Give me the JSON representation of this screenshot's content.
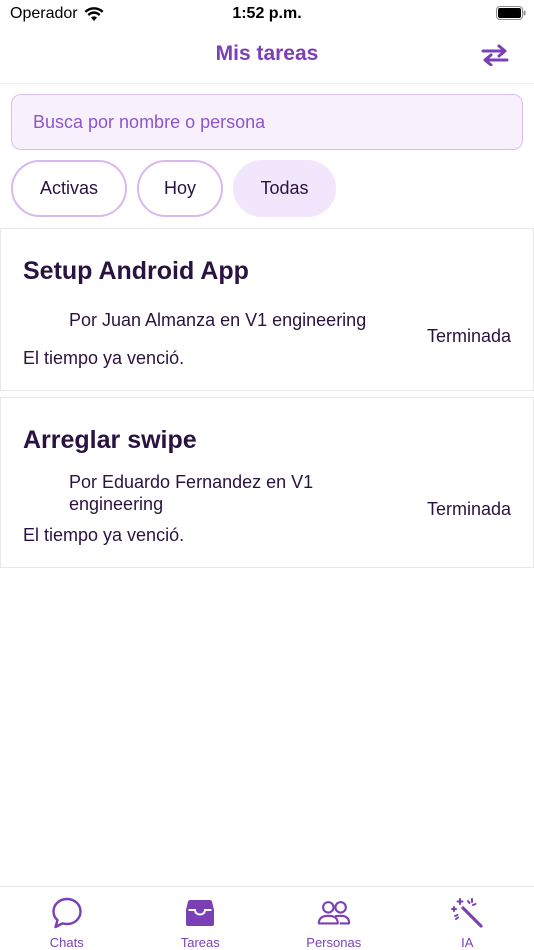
{
  "status_bar": {
    "carrier": "Operador",
    "time": "1:52 p.m."
  },
  "header": {
    "title": "Mis tareas",
    "swap_icon": "swap-arrows-icon"
  },
  "search": {
    "placeholder": "Busca por nombre o persona",
    "value": ""
  },
  "filters": [
    {
      "label": "Activas",
      "selected": false
    },
    {
      "label": "Hoy",
      "selected": false
    },
    {
      "label": "Todas",
      "selected": true
    }
  ],
  "tasks": [
    {
      "title": "Setup Android App",
      "author": "Por Juan Almanza en V1 engineering",
      "status": "Terminada",
      "due": "El tiempo ya venció."
    },
    {
      "title": "Arreglar swipe",
      "author": "Por Eduardo Fernandez en V1 engineering",
      "status": "Terminada",
      "due": "El tiempo ya venció."
    }
  ],
  "tab_bar": {
    "items": [
      {
        "label": "Chats",
        "icon": "chat-bubble-icon",
        "active": false
      },
      {
        "label": "Tareas",
        "icon": "inbox-tray-icon",
        "active": true
      },
      {
        "label": "Personas",
        "icon": "people-icon",
        "active": false
      },
      {
        "label": "IA",
        "icon": "magic-wand-icon",
        "active": false
      }
    ]
  },
  "colors": {
    "accent": "#7b3fb6",
    "chip_border": "#d7b9f0",
    "chip_selected_bg": "#f1e6fb",
    "search_bg": "#f8f1fd",
    "text": "#2a1340"
  }
}
